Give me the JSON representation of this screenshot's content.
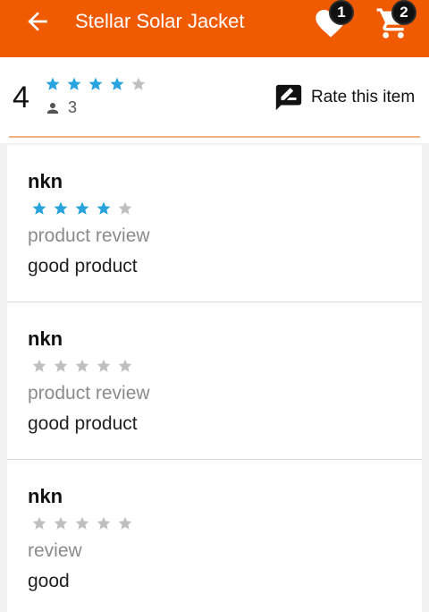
{
  "header": {
    "title": "Stellar Solar Jacket",
    "wishlist_count": "1",
    "cart_count": "2",
    "accent_color": "#f05a00",
    "icons": [
      "back-arrow-icon",
      "heart-icon",
      "cart-icon"
    ]
  },
  "summary": {
    "average": "4",
    "rating": 4,
    "max_rating": 5,
    "reviewer_count": "3",
    "rate_label": "Rate this item",
    "star_color_filled": "#29a3e0",
    "star_color_empty": "#c0c0c0"
  },
  "reviews": [
    {
      "author": "nkn",
      "rating": 4,
      "title": "product review",
      "body": "good product"
    },
    {
      "author": "nkn",
      "rating": 0,
      "title": "product review",
      "body": "good product"
    },
    {
      "author": "nkn",
      "rating": 0,
      "title": "review",
      "body": "good"
    }
  ]
}
